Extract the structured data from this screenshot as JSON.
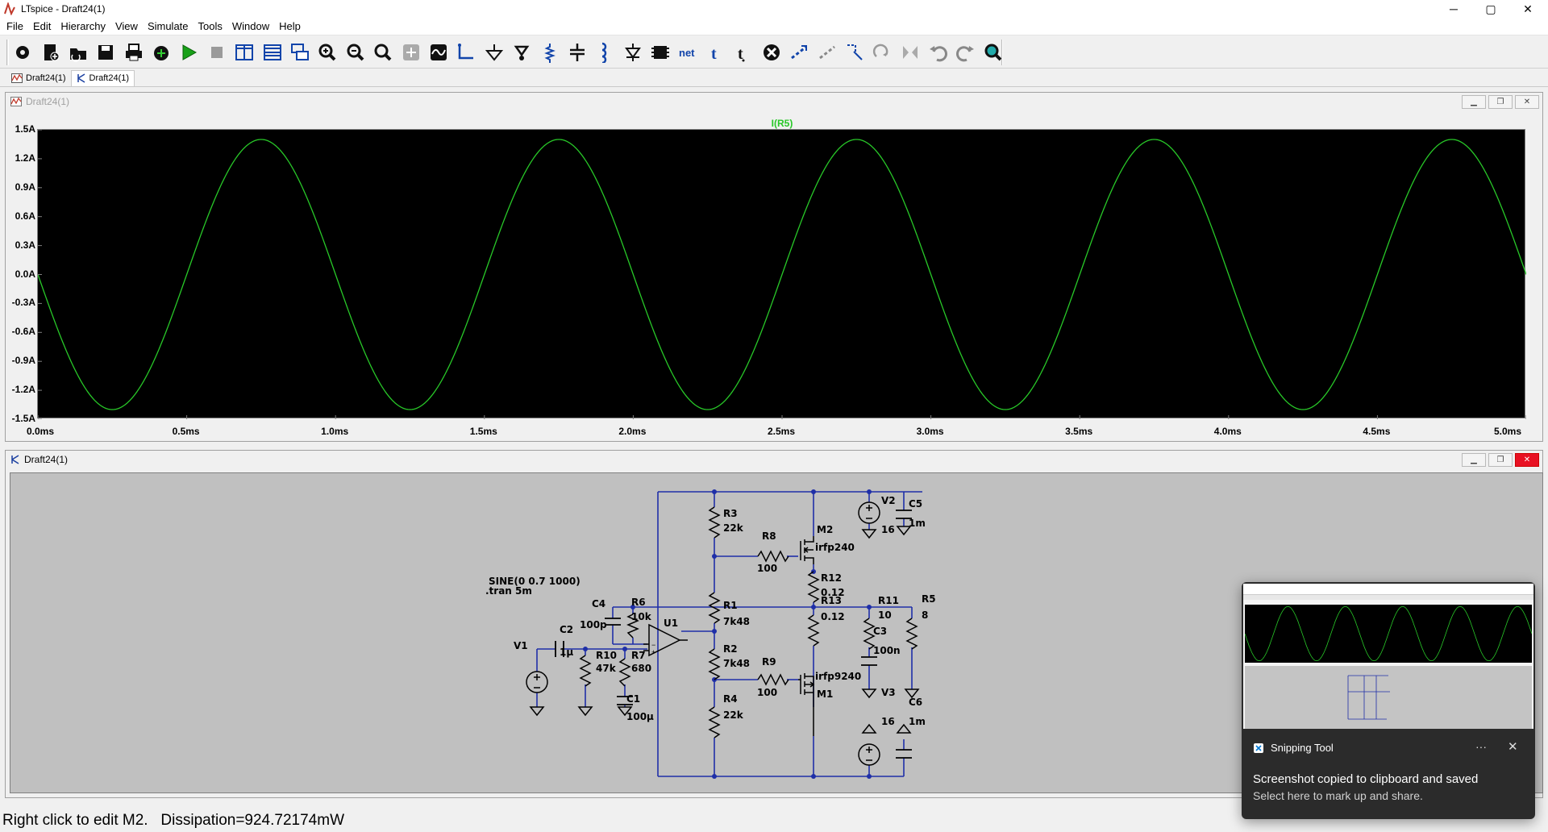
{
  "window": {
    "title": "LTspice - Draft24(1)"
  },
  "menu": [
    "File",
    "Edit",
    "Hierarchy",
    "View",
    "Simulate",
    "Tools",
    "Window",
    "Help"
  ],
  "toolbar": {
    "icons": [
      "settings-icon",
      "new-schematic-icon",
      "open-icon",
      "save-icon",
      "print-icon",
      "control-panel-icon",
      "run-icon",
      "halt-icon",
      "tile-vertical-icon",
      "tile-horizontal-icon",
      "cascade-icon",
      "zoom-in-icon",
      "zoom-out-icon",
      "zoom-fit-icon",
      "autorange-icon",
      "pick-visible-traces-icon",
      "wire-icon",
      "ground-icon",
      "label-net-icon",
      "resistor-icon",
      "capacitor-icon",
      "inductor-icon",
      "diode-icon",
      "component-icon",
      "net-label-icon",
      "text-icon",
      "spice-directive-icon",
      "delete-icon",
      "duplicate-icon",
      "move-icon",
      "drag-icon",
      "rotate-icon",
      "mirror-icon",
      "undo-icon",
      "redo-icon",
      "find-icon"
    ],
    "net_text": "net"
  },
  "tabs": [
    {
      "label": "Draft24(1)",
      "icon": "waveform-icon"
    },
    {
      "label": "Draft24(1)",
      "icon": "schematic-icon"
    }
  ],
  "waveform_window": {
    "title": "Draft24(1)",
    "trace_name": "I(R5)",
    "trace_color": "#28c828"
  },
  "chart_data": {
    "type": "line",
    "title": "I(R5)",
    "xlabel": "",
    "ylabel": "",
    "x_ticks": [
      "0.0ms",
      "0.5ms",
      "1.0ms",
      "1.5ms",
      "2.0ms",
      "2.5ms",
      "3.0ms",
      "3.5ms",
      "4.0ms",
      "4.5ms",
      "5.0ms"
    ],
    "y_ticks": [
      "1.5A",
      "1.2A",
      "0.9A",
      "0.6A",
      "0.3A",
      "0.0A",
      "-0.3A",
      "-0.6A",
      "-0.9A",
      "-1.2A",
      "-1.5A"
    ],
    "xlim": [
      0,
      5.0
    ],
    "ylim": [
      -1.5,
      1.5
    ],
    "series": [
      {
        "name": "I(R5)",
        "color": "#28c828",
        "function": "-1.4*sin(2*pi*1000*t)",
        "amplitude": 1.4,
        "frequency_hz": 1000,
        "x": [
          0.0,
          0.25,
          0.5,
          0.75,
          1.0,
          1.25,
          1.5,
          1.75,
          2.0,
          2.25,
          2.5,
          2.75,
          3.0,
          3.25,
          3.5,
          3.75,
          4.0,
          4.25,
          4.5,
          4.75,
          5.0
        ],
        "values": [
          0.0,
          -1.4,
          0.0,
          1.4,
          0.0,
          -1.4,
          0.0,
          1.4,
          0.0,
          -1.4,
          0.0,
          1.4,
          0.0,
          -1.4,
          0.0,
          1.4,
          0.0,
          -1.4,
          0.0,
          1.4,
          0.0
        ]
      }
    ],
    "grid": false
  },
  "schematic_window": {
    "title": "Draft24(1)",
    "directive_source": "SINE(0 0.7 1000)",
    "directive_tran": ".tran 5m",
    "components": {
      "R3": {
        "name": "R3",
        "value": "22k"
      },
      "R8": {
        "name": "R8",
        "value": "100"
      },
      "M2": {
        "name": "M2",
        "value": "irfp240"
      },
      "R12": {
        "name": "R12",
        "value": "0.12"
      },
      "V2": {
        "name": "V2",
        "value": "16"
      },
      "C5": {
        "name": "C5",
        "value": "1m"
      },
      "C4": {
        "name": "C4",
        "value": "100p"
      },
      "R6": {
        "name": "R6",
        "value": "10k"
      },
      "U1": {
        "name": "U1"
      },
      "R1": {
        "name": "R1",
        "value": "7k48"
      },
      "R13": {
        "name": "R13",
        "value": "0.12"
      },
      "R11": {
        "name": "R11",
        "value": "10"
      },
      "R5": {
        "name": "R5",
        "value": "8"
      },
      "C3": {
        "name": "C3",
        "value": "100n"
      },
      "C2": {
        "name": "C2",
        "value": "1µ"
      },
      "V1": {
        "name": "V1"
      },
      "R10": {
        "name": "R10",
        "value": "47k"
      },
      "R7": {
        "name": "R7",
        "value": "680"
      },
      "R2": {
        "name": "R2",
        "value": "7k48"
      },
      "R9": {
        "name": "R9",
        "value": "100"
      },
      "M1": {
        "name": "M1",
        "value": "irfp9240"
      },
      "V3": {
        "name": "V3",
        "value": "16"
      },
      "C6": {
        "name": "C6",
        "value": "1m"
      },
      "C1": {
        "name": "C1",
        "value": "100µ"
      },
      "R4": {
        "name": "R4",
        "value": "22k"
      }
    }
  },
  "status": {
    "text": "Right click to edit M2.   Dissipation=924.72174mW"
  },
  "toast": {
    "app_name": "Snipping Tool",
    "more": "···",
    "close": "✕",
    "message": "Screenshot copied to clipboard and saved",
    "sub": "Select here to mark up and share."
  },
  "window_controls": {
    "minimize": "─",
    "maximize": "▢",
    "close": "✕"
  }
}
